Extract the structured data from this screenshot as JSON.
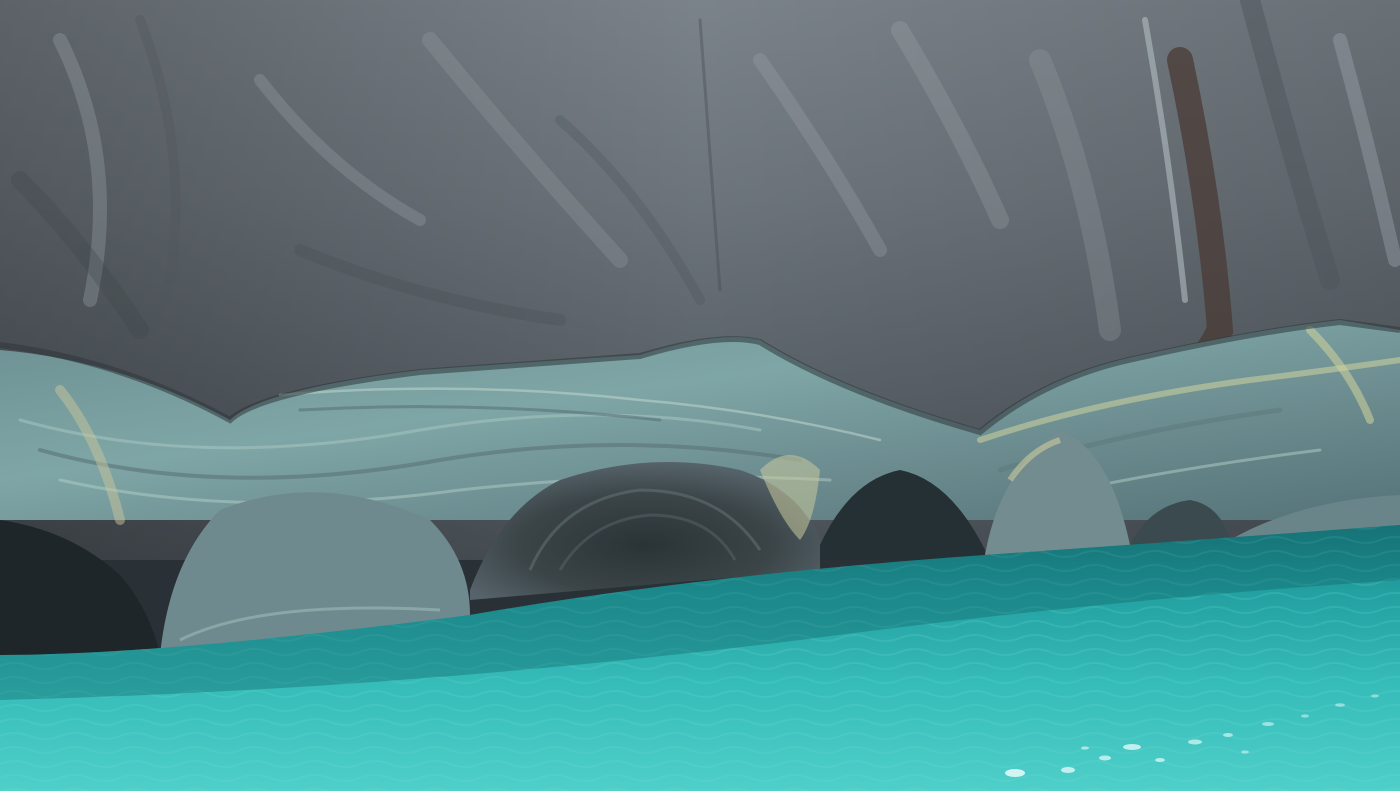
{
  "scene": {
    "subject": "marble-caves",
    "colors": {
      "rock_light": "#8a9299",
      "rock_mid": "#5f676d",
      "rock_dark": "#3c4247",
      "marble_teal": "#5fa6a4",
      "marble_pale": "#a9c9b9",
      "marble_yellow": "#c9c79a",
      "cave_shadow": "#1f2a2d",
      "water_deep": "#1c8f92",
      "water_mid": "#2fb4b3",
      "water_light": "#56d0cc",
      "water_glint": "#e8fbfa"
    }
  }
}
